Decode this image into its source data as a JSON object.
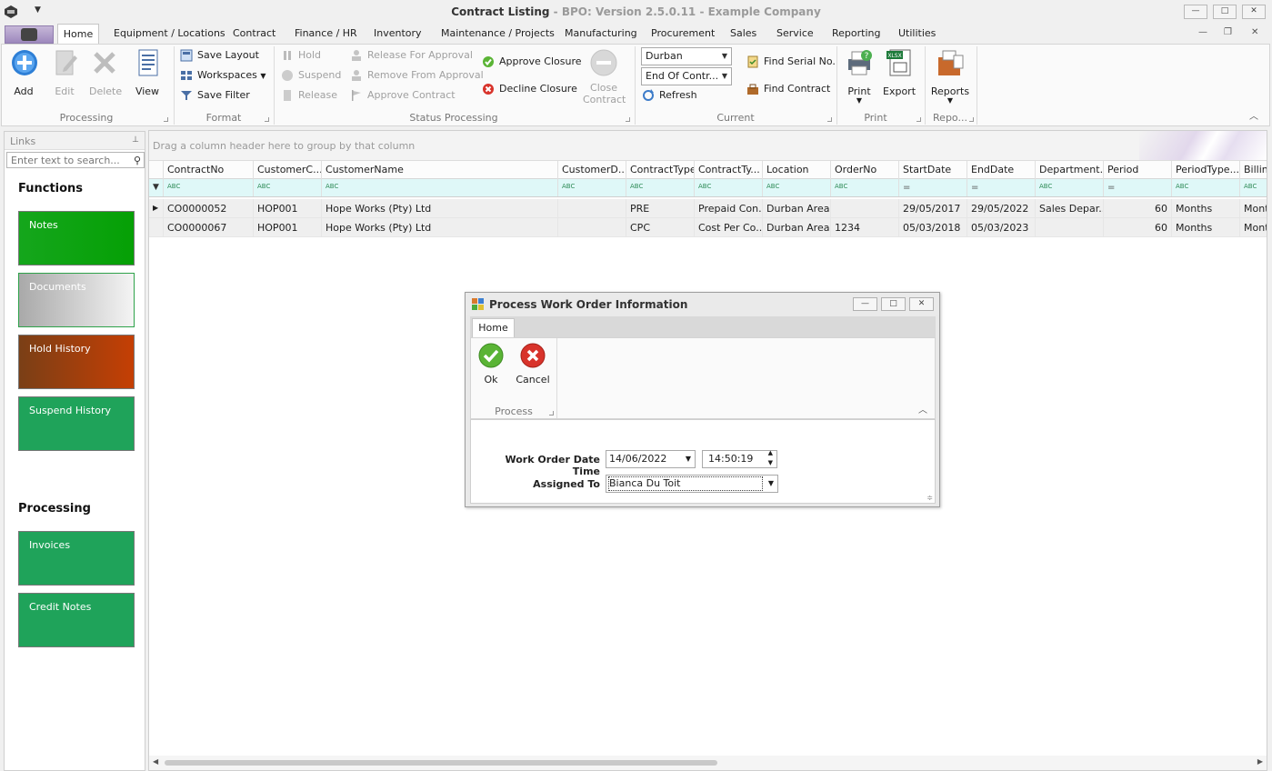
{
  "window": {
    "title_main": "Contract Listing",
    "title_dim": " - BPO: Version 2.5.0.11 - Example Company"
  },
  "ribbon_tabs": [
    "Home",
    "Equipment / Locations",
    "Contract",
    "Finance / HR",
    "Inventory",
    "Maintenance / Projects",
    "Manufacturing",
    "Procurement",
    "Sales",
    "Service",
    "Reporting",
    "Utilities"
  ],
  "ribbon": {
    "processing": {
      "caption": "Processing",
      "add": "Add",
      "edit": "Edit",
      "delete": "Delete",
      "view": "View"
    },
    "format": {
      "caption": "Format",
      "save_layout": "Save Layout",
      "workspaces": "Workspaces",
      "save_filter": "Save Filter"
    },
    "status": {
      "caption": "Status Processing",
      "hold": "Hold",
      "suspend": "Suspend",
      "release": "Release",
      "release_for_approval": "Release For Approval",
      "remove_from_approval": "Remove From Approval",
      "approve_contract": "Approve Contract",
      "approve_closure": "Approve Closure",
      "decline_closure": "Decline Closure",
      "close_contract_1": "Close",
      "close_contract_2": "Contract"
    },
    "current": {
      "caption": "Current",
      "location": "Durban",
      "filter": "End Of Contr...",
      "refresh": "Refresh",
      "find_serial": "Find Serial No.",
      "find_contract": "Find Contract"
    },
    "print": {
      "caption": "Print",
      "print": "Print",
      "export": "Export"
    },
    "reports": {
      "caption": "Repo...",
      "reports": "Reports"
    }
  },
  "links": {
    "header": "Links",
    "search_placeholder": "Enter text to search...",
    "functions_title": "Functions",
    "functions": [
      "Notes",
      "Documents",
      "Hold History",
      "Suspend History"
    ],
    "processing_title": "Processing",
    "processing": [
      "Invoices",
      "Credit Notes"
    ]
  },
  "grid": {
    "group_hint": "Drag a column header here to group by that column",
    "columns": [
      "ContractNo",
      "CustomerC...",
      "CustomerName",
      "CustomerD...",
      "ContractType",
      "ContractTy...",
      "Location",
      "OrderNo",
      "StartDate",
      "EndDate",
      "Department...",
      "Period",
      "PeriodType...",
      "Billing"
    ],
    "filter_abc": "ABC",
    "filter_eq": "=",
    "rows": [
      [
        "CO0000052",
        "HOP001",
        "Hope Works (Pty) Ltd",
        "",
        "PRE",
        "Prepaid Con...",
        "Durban Area",
        "",
        "29/05/2017",
        "29/05/2022",
        "Sales Depar...",
        "60",
        "Months",
        "Month"
      ],
      [
        "CO0000067",
        "HOP001",
        "Hope Works (Pty) Ltd",
        "",
        "CPC",
        "Cost Per Co...",
        "Durban Area",
        "1234",
        "05/03/2018",
        "05/03/2023",
        "",
        "60",
        "Months",
        "Month"
      ]
    ]
  },
  "dialog": {
    "title": "Process Work Order Information",
    "tab": "Home",
    "ok": "Ok",
    "cancel": "Cancel",
    "group": "Process",
    "date_label": "Work Order Date Time",
    "date_value": "14/06/2022",
    "time_value": "14:50:19",
    "assigned_label": "Assigned To",
    "assigned_value": "Bianca Du Toit"
  },
  "colors": {
    "tile_green": "#1fa35a",
    "tile_notes": "#06a406",
    "tile_hold": "#a83a0a",
    "filter_row": "#dff8f8",
    "accent_purple": "#9d88bd"
  }
}
